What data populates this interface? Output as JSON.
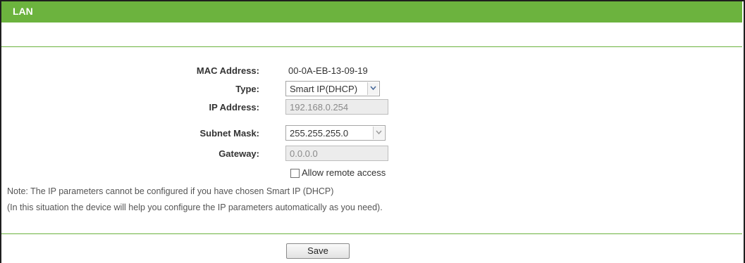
{
  "header": {
    "title": "LAN"
  },
  "form": {
    "mac": {
      "label": "MAC Address:",
      "value": "00-0A-EB-13-09-19"
    },
    "type": {
      "label": "Type:",
      "selected": "Smart IP(DHCP)"
    },
    "ip": {
      "label": "IP Address:",
      "value": "192.168.0.254"
    },
    "subnet": {
      "label": "Subnet Mask:",
      "selected": "255.255.255.0"
    },
    "gateway": {
      "label": "Gateway:",
      "value": "0.0.0.0"
    },
    "remote_access": {
      "label": "Allow remote access",
      "checked": false
    }
  },
  "note": {
    "line1": "Note: The IP parameters cannot be configured if you have chosen Smart IP (DHCP)",
    "line2": "(In this situation the device will help you configure the IP parameters automatically as you need)."
  },
  "actions": {
    "save_label": "Save"
  },
  "colors": {
    "header_bg": "#6cb33e",
    "divider": "#6cb33e"
  }
}
